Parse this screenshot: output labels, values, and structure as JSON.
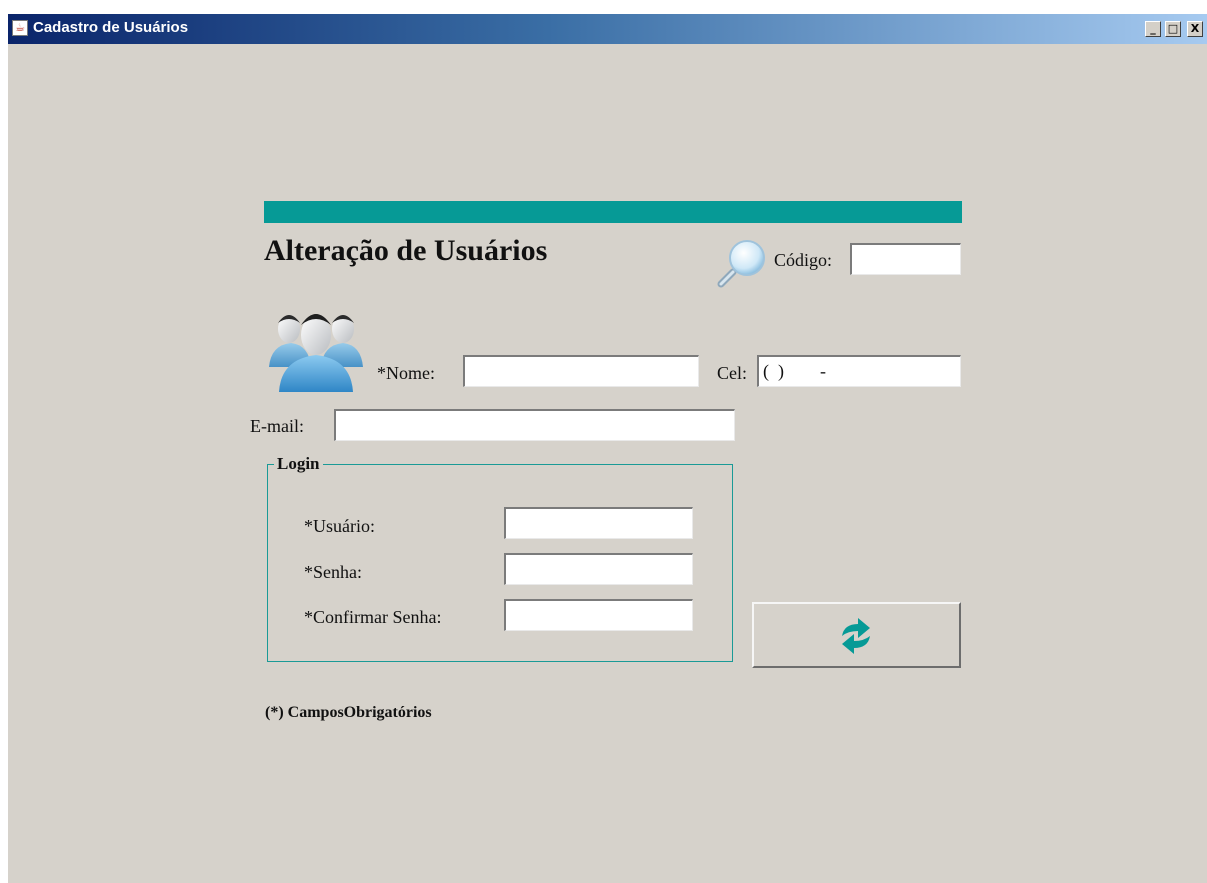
{
  "window": {
    "title": "Cadastro de Usuários",
    "controls": {
      "minimize": "_",
      "maximize": "□",
      "close": "X"
    }
  },
  "form": {
    "heading": "Alteração de Usuários",
    "codigo": {
      "label": "Código:",
      "value": ""
    },
    "nome": {
      "label": "*Nome:",
      "value": ""
    },
    "cel": {
      "label": "Cel:",
      "value": "(  )        -"
    },
    "email": {
      "label": "E-mail:",
      "value": ""
    },
    "login": {
      "legend": "Login",
      "usuario": {
        "label": "*Usuário:",
        "value": ""
      },
      "senha": {
        "label": "*Senha:",
        "value": ""
      },
      "confirmar": {
        "label": "*Confirmar Senha:",
        "value": ""
      }
    },
    "footnote": "(*) CamposObrigatórios"
  },
  "icons": {
    "title": "java-cup-icon",
    "search": "magnifier-icon",
    "users": "users-group-icon",
    "refresh": "refresh-icon"
  },
  "colors": {
    "accent": "#069a96",
    "background": "#d6d2cb"
  }
}
